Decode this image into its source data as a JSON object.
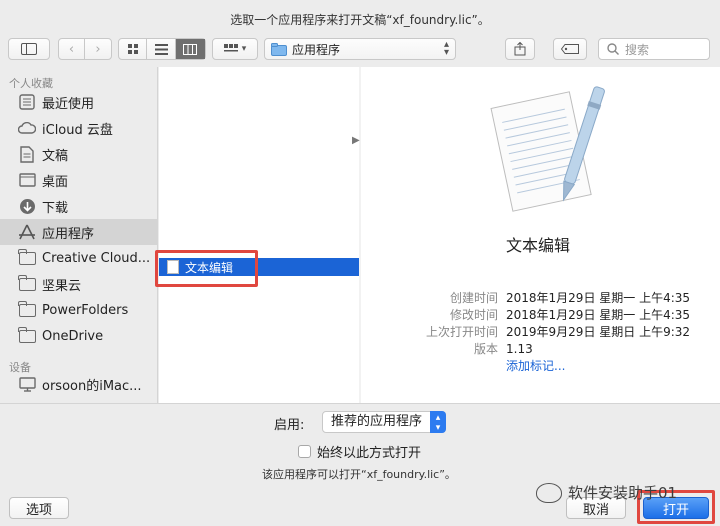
{
  "dialog": {
    "title": "选取一个应用程序来打开文稿“xf_foundry.lic”。"
  },
  "toolbar": {
    "location": "应用程序",
    "search_placeholder": "搜索"
  },
  "sidebar": {
    "favorites_title": "个人收藏",
    "favorites": [
      {
        "label": "最近使用",
        "icon": "recents-icon"
      },
      {
        "label": "iCloud 云盘",
        "icon": "icloud-icon"
      },
      {
        "label": "文稿",
        "icon": "documents-icon"
      },
      {
        "label": "桌面",
        "icon": "desktop-icon"
      },
      {
        "label": "下载",
        "icon": "downloads-icon"
      },
      {
        "label": "应用程序",
        "icon": "applications-icon",
        "selected": true
      },
      {
        "label": "Creative Cloud...",
        "icon": "folder-icon"
      },
      {
        "label": "坚果云",
        "icon": "folder-icon"
      },
      {
        "label": "PowerFolders",
        "icon": "folder-icon"
      },
      {
        "label": "OneDrive",
        "icon": "folder-icon"
      }
    ],
    "devices_title": "设备",
    "devices": [
      {
        "label": "orsoon的iMac...",
        "icon": "imac-icon"
      }
    ]
  },
  "browser": {
    "selected_item": "文本编辑"
  },
  "preview": {
    "app_name": "文本编辑",
    "info": [
      {
        "key": "创建时间",
        "value": "2018年1月29日 星期一 上午4:35"
      },
      {
        "key": "修改时间",
        "value": "2018年1月29日 星期一 上午4:35"
      },
      {
        "key": "上次打开时间",
        "value": "2019年9月29日 星期日 上午9:32"
      },
      {
        "key": "版本",
        "value": "1.13"
      }
    ],
    "add_tags": "添加标记..."
  },
  "options": {
    "enable_label": "启用:",
    "enable_value": "推荐的应用程序",
    "always_open_label": "始终以此方式打开",
    "note": "该应用程序可以打开“xf_foundry.lic”。"
  },
  "buttons": {
    "options": "选项",
    "cancel": "取消",
    "open": "打开"
  },
  "watermark": {
    "text": "软件安装助手01"
  },
  "colors": {
    "accent": "#1b64d6",
    "highlight": "#e0473f"
  }
}
